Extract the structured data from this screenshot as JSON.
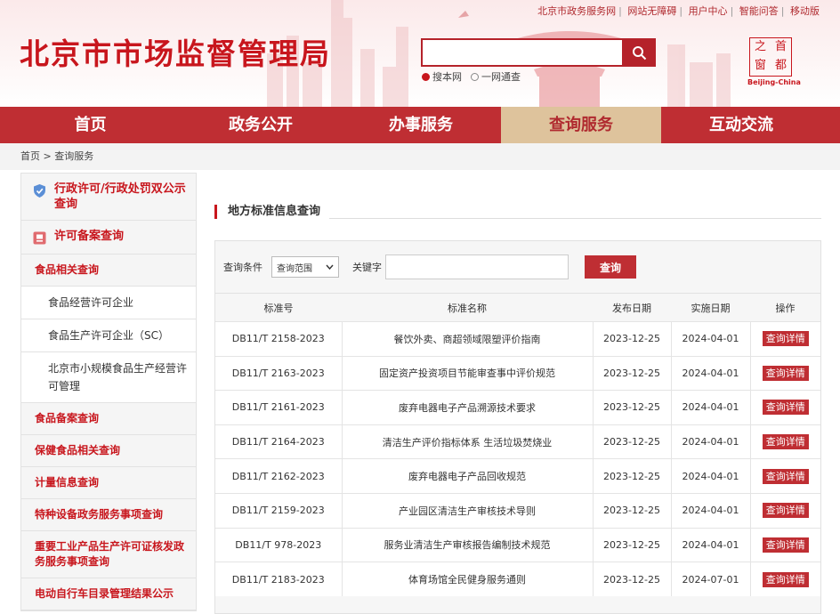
{
  "header": {
    "site_title": "北京市市场监督管理局",
    "top_links": [
      "北京市政务服务网",
      "网站无障碍",
      "用户中心",
      "智能问答",
      "移动版"
    ],
    "search_placeholder": "",
    "radio_options": [
      {
        "label": "搜本网",
        "selected": true
      },
      {
        "label": "一网通查",
        "selected": false
      }
    ],
    "seal_chars": [
      "之",
      "首",
      "窗",
      "都"
    ],
    "seal_caption": "Beijing-China"
  },
  "nav": {
    "items": [
      "首页",
      "政务公开",
      "办事服务",
      "查询服务",
      "互动交流"
    ],
    "active_index": 3
  },
  "breadcrumb": {
    "home": "首页",
    "current": "查询服务",
    "separator": ">"
  },
  "sidebar": {
    "headers": [
      {
        "label": "行政许可/行政处罚双公示查询",
        "icon": "shield-icon"
      },
      {
        "label": "许可备案查询",
        "icon": "license-icon"
      }
    ],
    "group_food": "食品相关查询",
    "sub_items": [
      "食品经营许可企业",
      "食品生产许可企业（SC）",
      "北京市小规模食品生产经营许可管理"
    ],
    "more_items": [
      "食品备案查询",
      "保健食品相关查询",
      "计量信息查询",
      "特种设备政务服务事项查询",
      "重要工业产品生产许可证核发政务服务事项查询",
      "电动自行车目录管理结果公示"
    ]
  },
  "main": {
    "section_title": "地方标准信息查询",
    "query": {
      "label": "查询条件",
      "select_value": "查询范围",
      "keyword_label": "关键字",
      "keyword_value": "",
      "button_label": "查询"
    },
    "table": {
      "headers": [
        "标准号",
        "标准名称",
        "发布日期",
        "实施日期",
        "操作"
      ],
      "action_label": "查询详情",
      "rows": [
        {
          "code": "DB11/T 2158-2023",
          "name": "餐饮外卖、商超领域限塑评价指南",
          "issued": "2023-12-25",
          "effective": "2024-04-01"
        },
        {
          "code": "DB11/T 2163-2023",
          "name": "固定资产投资项目节能审查事中评价规范",
          "issued": "2023-12-25",
          "effective": "2024-04-01"
        },
        {
          "code": "DB11/T 2161-2023",
          "name": "废弃电器电子产品溯源技术要求",
          "issued": "2023-12-25",
          "effective": "2024-04-01"
        },
        {
          "code": "DB11/T 2164-2023",
          "name": "清洁生产评价指标体系 生活垃圾焚烧业",
          "issued": "2023-12-25",
          "effective": "2024-04-01"
        },
        {
          "code": "DB11/T 2162-2023",
          "name": "废弃电器电子产品回收规范",
          "issued": "2023-12-25",
          "effective": "2024-04-01"
        },
        {
          "code": "DB11/T 2159-2023",
          "name": "产业园区清洁生产审核技术导则",
          "issued": "2023-12-25",
          "effective": "2024-04-01"
        },
        {
          "code": "DB11/T 978-2023",
          "name": "服务业清洁生产审核报告编制技术规范",
          "issued": "2023-12-25",
          "effective": "2024-04-01"
        },
        {
          "code": "DB11/T 2183-2023",
          "name": "体育场馆全民健身服务通则",
          "issued": "2023-12-25",
          "effective": "2024-07-01"
        }
      ]
    }
  },
  "colors": {
    "brand_red": "#c8161d",
    "nav_red": "#bf2e33",
    "nav_active": "#dec39c"
  }
}
